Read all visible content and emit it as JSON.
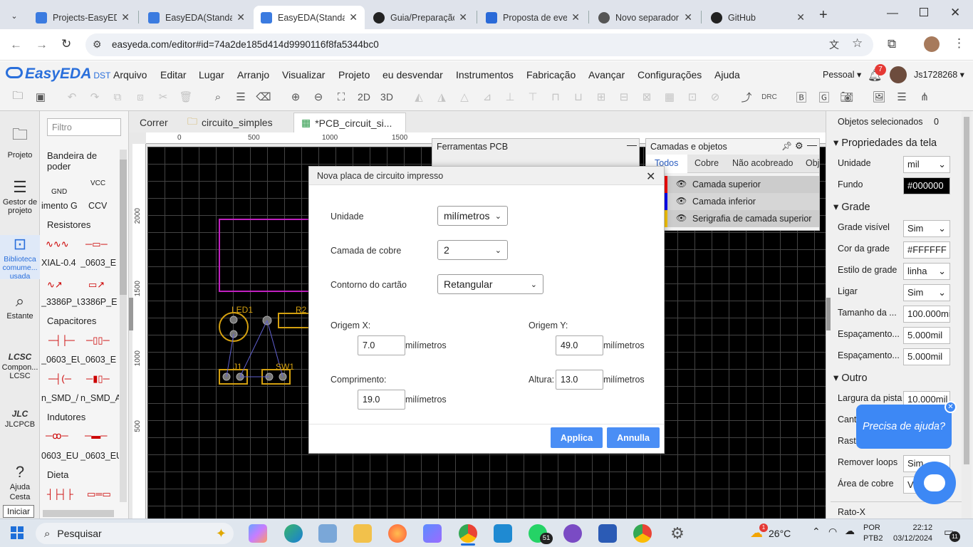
{
  "browser": {
    "tabs": [
      {
        "title": "Projects-EasyEDA",
        "icon_color": "#3b7be0"
      },
      {
        "title": "EasyEDA(Standa",
        "icon_color": "#3b7be0"
      },
      {
        "title": "EasyEDA(Standa",
        "icon_color": "#3b7be0"
      },
      {
        "title": "Guia/Preparação",
        "icon_color": "#222"
      },
      {
        "title": "Proposta de eve",
        "icon_color": "#2a6ad8"
      },
      {
        "title": "Novo separador",
        "icon_color": "#555"
      },
      {
        "title": "GitHub",
        "icon_color": "#222"
      }
    ],
    "url": "easyeda.com/editor#id=74a2de185d414d9990116f8fa5344bc0"
  },
  "app": {
    "logo": "EasyEDA",
    "logo_sub": "DST",
    "menu": [
      "Arquivo",
      "Editar",
      "Lugar",
      "Arranjo",
      "Visualizar",
      "Projeto",
      "eu desvendar",
      "Instrumentos",
      "Fabricação",
      "Avançar",
      "Configurações",
      "Ajuda"
    ],
    "account_mode": "Pessoal",
    "notifications": "7",
    "username": "Js1728268",
    "toolbar_2d": "2D",
    "toolbar_3d": "3D",
    "toolbar_drc": "DRC"
  },
  "leftnav": [
    {
      "label": "Projeto",
      "icon": "folder-icon"
    },
    {
      "label": "Gestor de projeto",
      "icon": "list-icon"
    },
    {
      "label": "Biblioteca comume... usada",
      "icon": "chip-icon"
    },
    {
      "label": "Estante",
      "icon": "search-icon"
    },
    {
      "label": "Compon... LCSC",
      "icon": "lcsc-icon"
    },
    {
      "label": "JLCPCB",
      "icon": "jlc-icon"
    },
    {
      "label": "Ajuda",
      "icon": "help-icon"
    },
    {
      "label": "Cesta",
      "icon": "trash-icon"
    }
  ],
  "leftnav_tooltip": "Iniciar",
  "library": {
    "filter_placeholder": "Filtro",
    "sections": [
      "Bandeira de poder",
      "Resistores",
      "Capacitores",
      "Indutores",
      "Dieta"
    ],
    "items": {
      "gnd_symbol": "GND",
      "vcc_symbol": "VCC",
      "gnd": "imento G",
      "vcc": "CCV",
      "r1": "XIAL-0.4",
      "r2": "_0603_E",
      "r3": "_3386P_U",
      "r4": "3386P_E",
      "c1": "_0603_EU",
      "c2": "_0603_E",
      "c3": "n_SMD_/",
      "c4": "n_SMD_A",
      "l1": "0603_EU",
      "l2": "_0603_EU"
    }
  },
  "doctabs": [
    "Correr",
    "circuito_simples",
    "*PCB_circuit_si..."
  ],
  "ruler": {
    "top": [
      "0",
      "500",
      "1000",
      "1500"
    ],
    "left": [
      "2000",
      "1500",
      "1000",
      "500"
    ]
  },
  "pcb_labels": {
    "led": "LED1",
    "r2": "R2",
    "j1": "J1",
    "sw1": "SW1"
  },
  "pcb_tools": {
    "title": "Ferramentas PCB"
  },
  "layers_panel": {
    "title": "Camadas e objetos",
    "tabs": [
      "Todos",
      "Cobre",
      "Não acobreado",
      "Obj"
    ],
    "layers": [
      {
        "name": "Camada superior",
        "color": "#ff0000"
      },
      {
        "name": "Camada inferior",
        "color": "#0000ff"
      },
      {
        "name": "Serigrafia de camada superior",
        "color": "#ffcc00"
      }
    ]
  },
  "modal": {
    "title": "Nova placa de circuito impresso",
    "unit_label": "Unidade",
    "unit_value": "milímetros",
    "copper_label": "Camada de cobre",
    "copper_value": "2",
    "outline_label": "Contorno do cartão",
    "outline_value": "Retangular",
    "origin_x_label": "Origem X:",
    "origin_x": "7.0",
    "origin_y_label": "Origem Y:",
    "origin_y": "49.0",
    "length_label": "Comprimento:",
    "length": "19.0",
    "height_label": "Altura:",
    "height": "13.0",
    "unit_suffix": "milímetros",
    "apply": "Applica",
    "cancel": "Annulla"
  },
  "rpanel": {
    "selected_label": "Objetos selecionados",
    "selected_count": "0",
    "canvas_props": "Propriedades da tela",
    "unit_label": "Unidade",
    "unit": "mil",
    "bg_label": "Fundo",
    "bg": "#000000",
    "grid_section": "Grade",
    "grid_visible_label": "Grade visível",
    "grid_visible": "Sim",
    "grid_color_label": "Cor da grade",
    "grid_color": "#FFFFFF",
    "grid_style_label": "Estilo de grade",
    "grid_style": "linha",
    "snap_label": "Ligar",
    "snap": "Sim",
    "size_label": "Tamanho da ...",
    "size": "100.000mi",
    "spacing1_label": "Espaçamento...",
    "spacing1": "5.000mil",
    "spacing2_label": "Espaçamento...",
    "spacing2": "5.000mil",
    "other_section": "Outro",
    "track_label": "Largura da pista",
    "track": "10.000mil",
    "cant_label": "Cant",
    "rast_label": "Rast",
    "loops_label": "Remover loops",
    "loops": "Sim",
    "copper_area_label": "Área de cobre",
    "copper_area": "V",
    "ratox_label": "Rato-X"
  },
  "help_bubble": "Precisa de ajuda?",
  "taskbar": {
    "search": "Pesquisar",
    "weather": "26°C",
    "weather_badge": "1",
    "lang": "POR",
    "lang2": "PTB2",
    "time": "22:12",
    "date": "03/12/2024",
    "whatsapp_badge": "51",
    "notif_badge": "11"
  }
}
